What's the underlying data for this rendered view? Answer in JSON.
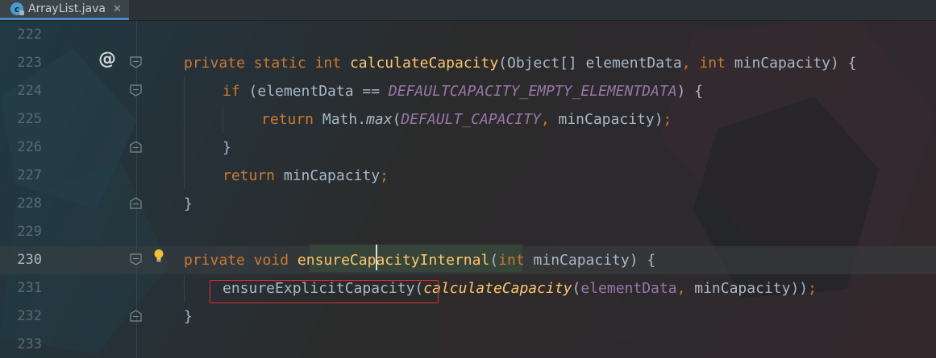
{
  "tab": {
    "icon": "c",
    "title": "ArrayList.java",
    "close": "✕"
  },
  "gutter": {
    "override_marker": "@"
  },
  "lines": [
    {
      "n": "222"
    },
    {
      "n": "223"
    },
    {
      "n": "224"
    },
    {
      "n": "225"
    },
    {
      "n": "226"
    },
    {
      "n": "227"
    },
    {
      "n": "228"
    },
    {
      "n": "229"
    },
    {
      "n": "230"
    },
    {
      "n": "231"
    },
    {
      "n": "232"
    },
    {
      "n": "233"
    }
  ],
  "code": {
    "l223": {
      "kw1": "private",
      "kw2": "static",
      "kw3": "int",
      "fn": "calculateCapacity",
      "p1": "(Object[] elementData",
      "comma": ",",
      "kw4": "int",
      "p2": "minCapacity) {"
    },
    "l224": {
      "kw": "if",
      "p1": " (elementData == ",
      "fld": "DEFAULTCAPACITY_EMPTY_ELEMENTDATA",
      "p2": ") {"
    },
    "l225": {
      "kw": "return",
      "p1": " Math.",
      "m": "max",
      "p2": "(",
      "fld": "DEFAULT_CAPACITY",
      "comma": ",",
      "p3": " minCapacity)",
      "semi": ";"
    },
    "l226": {
      "p": "}"
    },
    "l227": {
      "kw": "return",
      "p1": " minCapacity",
      "semi": ";"
    },
    "l228": {
      "p": "}"
    },
    "l230": {
      "kw1": "private",
      "kw2": "void",
      "fn": "ensureCapacityInternal",
      "p1": "(",
      "kw3": "int",
      "p2": " minCapacity) {"
    },
    "l231": {
      "call": "ensureExplicitCapacity",
      "p1": "(",
      "inner": "calculateCapacity",
      "p2": "(",
      "fld": "elementData",
      "comma": ",",
      "p3": " minCapacity))",
      "semi": ";"
    },
    "l232": {
      "p": "}"
    }
  },
  "colors": {
    "keyword": "#cc7832",
    "method": "#ffc66d",
    "field": "#9876aa",
    "text": "#a9b7c6",
    "highlight_box": "#e0302c"
  }
}
